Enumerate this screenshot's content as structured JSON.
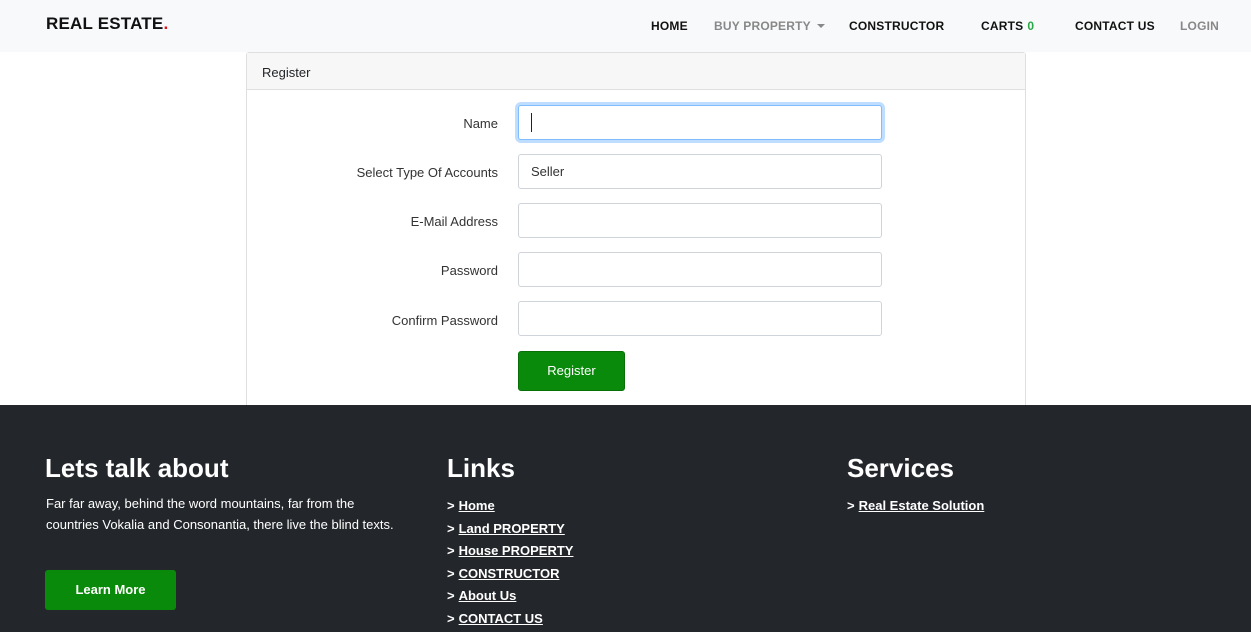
{
  "navbar": {
    "brand_text": "REAL ESTATE",
    "brand_dot": ".",
    "items": [
      {
        "label": "HOME"
      },
      {
        "label": "BUY PROPERTY"
      },
      {
        "label": "CONSTRUCTOR"
      },
      {
        "label": "CARTS",
        "count": "0"
      },
      {
        "label": "CONTACT US"
      },
      {
        "label": "LOGIN"
      }
    ]
  },
  "register": {
    "header": "Register",
    "fields": {
      "name": {
        "label": "Name",
        "value": ""
      },
      "account_type": {
        "label": "Select Type Of Accounts",
        "value": "Seller"
      },
      "email": {
        "label": "E-Mail Address",
        "value": ""
      },
      "password": {
        "label": "Password",
        "value": ""
      },
      "confirm_password": {
        "label": "Confirm Password",
        "value": ""
      }
    },
    "submit_label": "Register"
  },
  "footer": {
    "about": {
      "heading": "Lets talk about",
      "text": "Far far away, behind the word mountains, far from the countries Vokalia and Consonantia, there live the blind texts.",
      "button_label": "Learn More"
    },
    "links": {
      "heading": "Links",
      "arrow": ">",
      "items": [
        {
          "label": "Home"
        },
        {
          "label": "Land PROPERTY"
        },
        {
          "label": "House PROPERTY"
        },
        {
          "label": "CONSTRUCTOR"
        },
        {
          "label": "About Us"
        },
        {
          "label": "CONTACT US"
        }
      ]
    },
    "services": {
      "heading": "Services",
      "items": [
        {
          "label": "Real Estate Solution"
        }
      ]
    }
  },
  "colors": {
    "accent_green": "#0a8a0a",
    "brand_dot_red": "#e3121b",
    "footer_bg": "#23272b",
    "navbar_bg": "#f8f9fa",
    "cart_count_green": "#28a745"
  }
}
